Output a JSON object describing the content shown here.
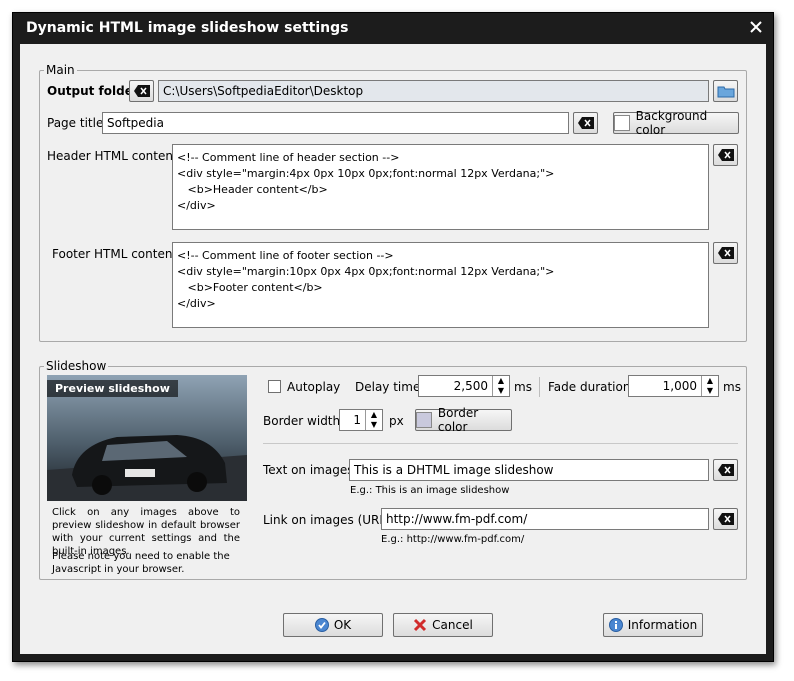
{
  "window": {
    "title": "Dynamic HTML image slideshow settings"
  },
  "main": {
    "group_label": "Main",
    "output_folder_label": "Output folder:",
    "output_folder_value": "C:\\Users\\SoftpediaEditor\\Desktop",
    "page_title_label": "Page title:",
    "page_title_value": "Softpedia",
    "background_color_label": "Background color",
    "header_label": "Header HTML content:",
    "header_value": "<!-- Comment line of header section -->\n<div style=\"margin:4px 0px 10px 0px;font:normal 12px Verdana;\">\n   <b>Header content</b>\n</div>",
    "footer_label": "Footer HTML content:",
    "footer_value": "<!-- Comment line of footer section -->\n<div style=\"margin:10px 0px 4px 0px;font:normal 12px Verdana;\">\n   <b>Footer content</b>\n</div>"
  },
  "slideshow": {
    "group_label": "Slideshow",
    "preview_label": "Preview slideshow",
    "preview_info": "Click on any images above to preview slideshow in default browser with your current settings and the built-in images.",
    "preview_note": "Please note you need to enable the Javascript in your browser.",
    "autoplay_label": "Autoplay",
    "delay_label": "Delay time:",
    "delay_value": "2,500",
    "delay_unit": "ms",
    "fade_label": "Fade duration:",
    "fade_value": "1,000",
    "fade_unit": "ms",
    "border_width_label": "Border width:",
    "border_width_value": "1",
    "border_width_unit": "px",
    "border_color_label": "Border color",
    "text_label": "Text on images:",
    "text_value": "This is a DHTML image slideshow",
    "text_hint": "E.g.: This is an image slideshow",
    "link_label": "Link on images (URL):",
    "link_value": "http://www.fm-pdf.com/",
    "link_hint": "E.g.: http://www.fm-pdf.com/"
  },
  "buttons": {
    "ok": "OK",
    "cancel": "Cancel",
    "information": "Information"
  },
  "colors": {
    "title_bar": "#1c1c1c",
    "client": "#f0f0f0",
    "accent": "#3c7fc9"
  }
}
